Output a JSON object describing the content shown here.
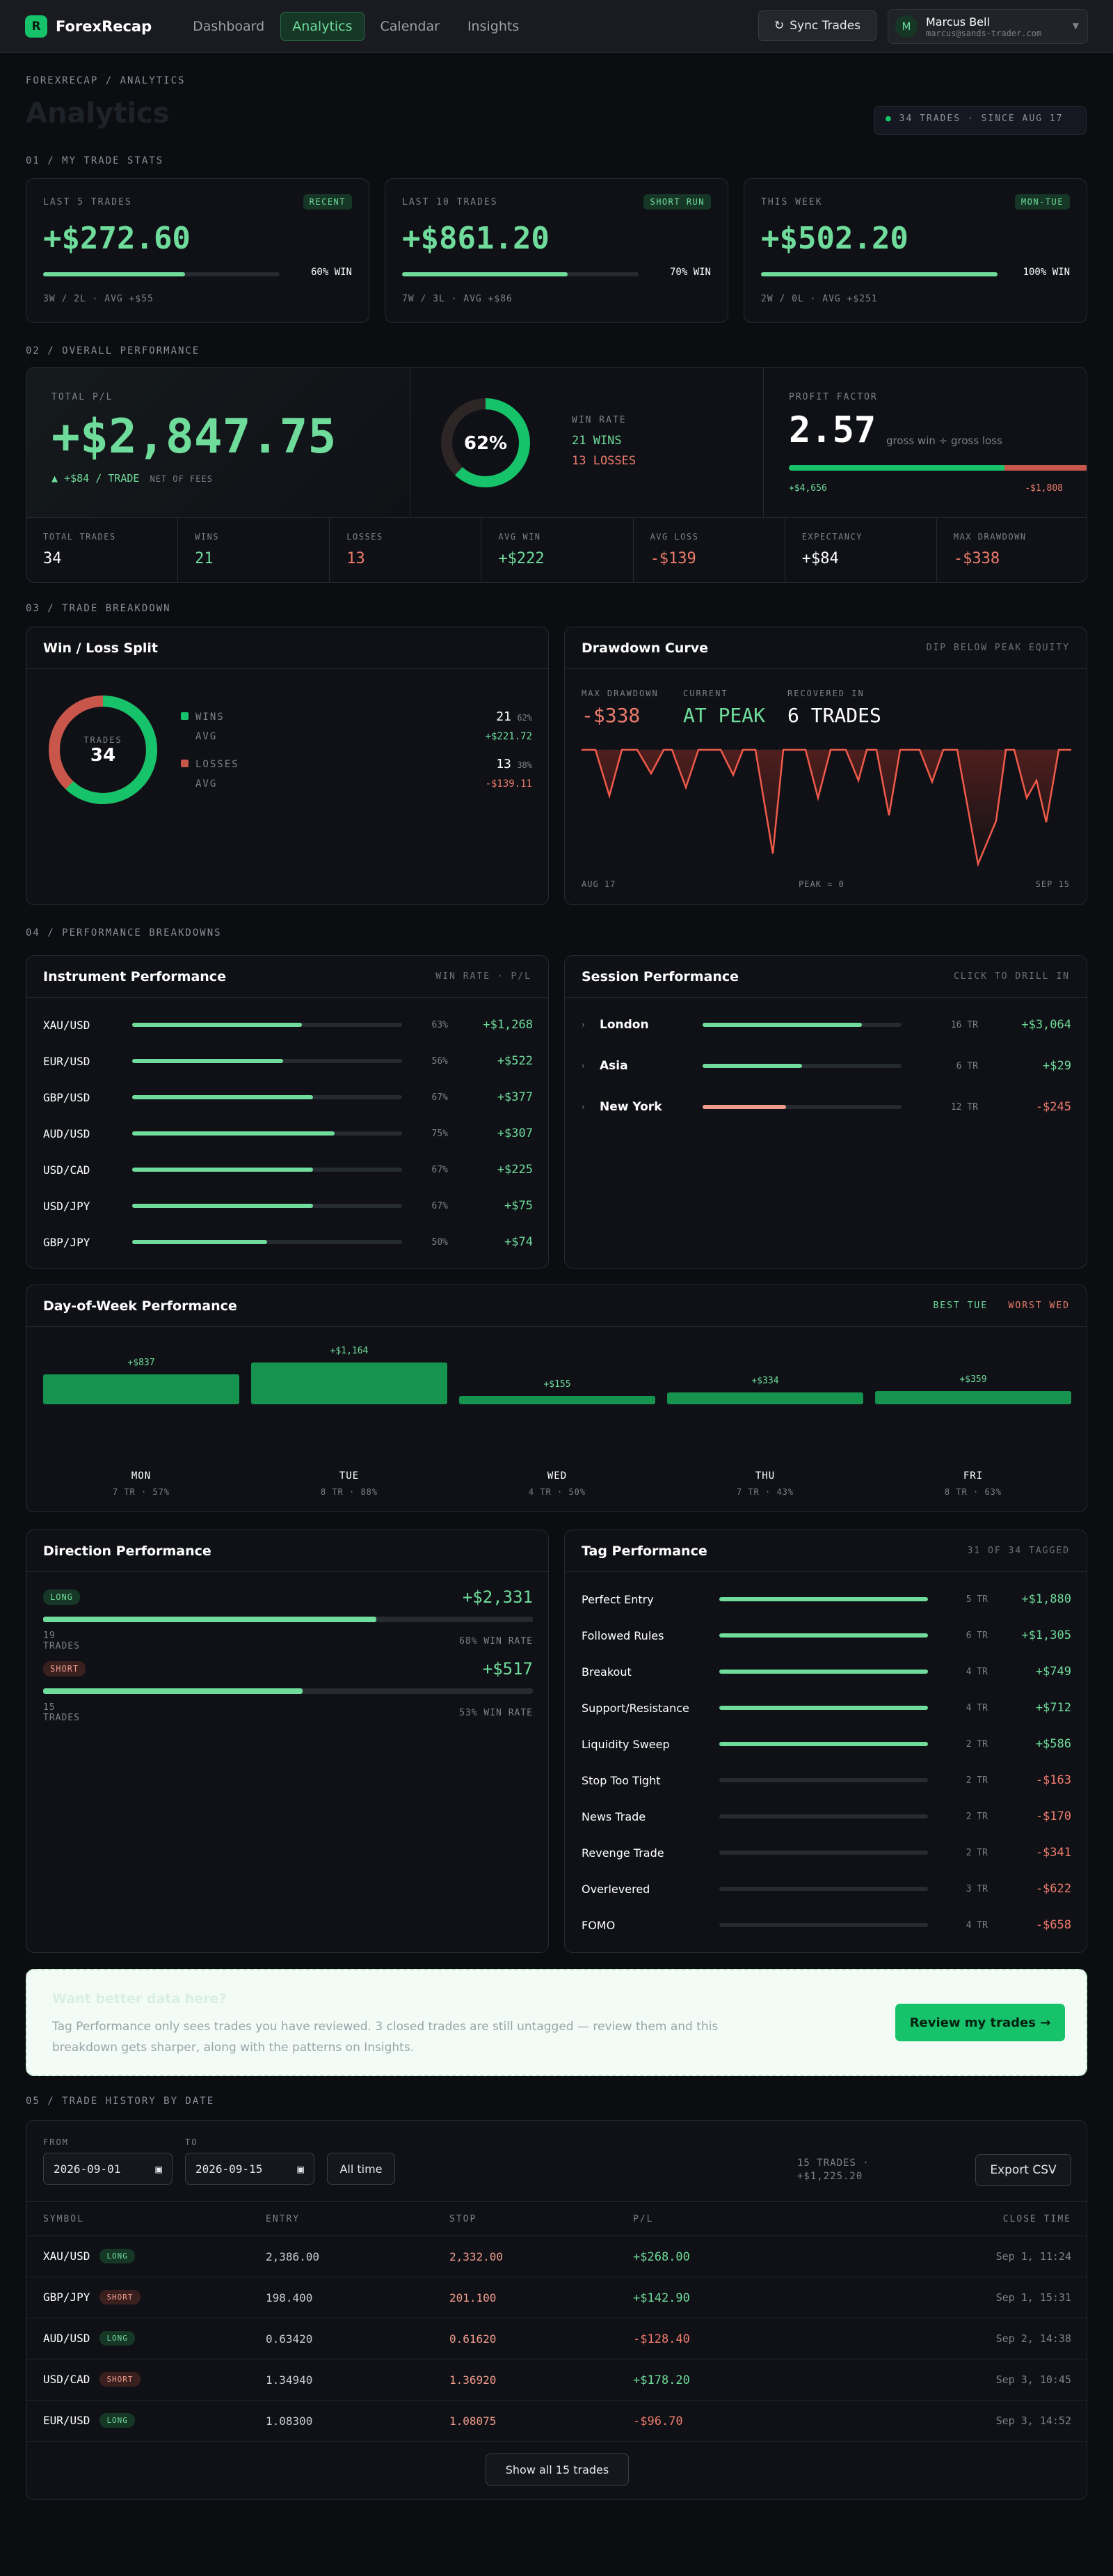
{
  "app": {
    "logo_letter": "R",
    "name": "ForexRecap",
    "nav": [
      "Dashboard",
      "Analytics",
      "Calendar",
      "Insights"
    ],
    "sync_label": "Sync Trades",
    "user": {
      "initial": "M",
      "name": "Marcus Bell",
      "email": "marcus@sands-trader.com"
    }
  },
  "header": {
    "breadcrumb": "FOREXRECAP / ANALYTICS",
    "title": "Analytics",
    "since": "34 TRADES · SINCE AUG 17"
  },
  "s1": {
    "label": "01 / MY TRADE STATS",
    "cards": [
      {
        "name": "LAST 5 TRADES",
        "badge": "RECENT",
        "value": "+$272.60",
        "pct": 60,
        "win": "60% WIN",
        "foot": "3W / 2L · AVG +$55"
      },
      {
        "name": "LAST 10 TRADES",
        "badge": "SHORT RUN",
        "value": "+$861.20",
        "pct": 70,
        "win": "70% WIN",
        "foot": "7W / 3L · AVG +$86"
      },
      {
        "name": "THIS WEEK",
        "badge": "MON-TUE",
        "value": "+$502.20",
        "pct": 100,
        "win": "100% WIN",
        "foot": "2W / 0L · AVG +$251"
      }
    ]
  },
  "s2": {
    "label": "02 / OVERALL PERFORMANCE",
    "total_label": "TOTAL P/L",
    "total": "+$2,847.75",
    "per_trade": "▲ +$84 / TRADE",
    "net": "NET OF FEES",
    "donut_pct": "62%",
    "win_rate_pct": 62,
    "wr_label": "WIN RATE",
    "wins": "21 WINS",
    "losses": "13 LOSSES",
    "pf_label": "PROFIT FACTOR",
    "pf": "2.57",
    "pf_desc": "gross win ÷ gross loss",
    "gross_win": "+$4,656",
    "gross_loss": "-$1,808",
    "gross_win_share": 72,
    "stats": [
      {
        "label": "TOTAL TRADES",
        "value": "34",
        "tone": "w"
      },
      {
        "label": "WINS",
        "value": "21",
        "tone": "g"
      },
      {
        "label": "LOSSES",
        "value": "13",
        "tone": "r"
      },
      {
        "label": "AVG WIN",
        "value": "+$222",
        "tone": "g"
      },
      {
        "label": "AVG LOSS",
        "value": "-$139",
        "tone": "r"
      },
      {
        "label": "EXPECTANCY",
        "value": "+$84",
        "tone": "w"
      },
      {
        "label": "MAX DRAWDOWN",
        "value": "-$338",
        "tone": "r"
      }
    ]
  },
  "s3": {
    "label": "03 / TRADE BREAKDOWN",
    "wl": {
      "title": "Win / Loss Split",
      "center_label": "TRADES",
      "center_value": "34",
      "wins_label": "WINS",
      "wins": "21",
      "wins_pct": "62%",
      "avg_label": "AVG",
      "avg_win": "+$221.72",
      "losses_label": "LOSSES",
      "losses": "13",
      "losses_pct": "38%",
      "avg_loss": "-$139.11",
      "win_share": 62
    },
    "dd": {
      "title": "Drawdown Curve",
      "hint": "DIP BELOW PEAK EQUITY",
      "max_label": "MAX DRAWDOWN",
      "max": "-$338",
      "cur_label": "CURRENT",
      "cur": "AT PEAK",
      "rec_label": "RECOVERED IN",
      "rec": "6 TRADES",
      "start": "AUG 17",
      "mid": "PEAK = 0",
      "end": "SEP 15"
    }
  },
  "s4": {
    "label": "04 / PERFORMANCE BREAKDOWNS",
    "instr": {
      "title": "Instrument Performance",
      "hint": "WIN RATE · P/L",
      "rows": [
        {
          "sym": "XAU/USD",
          "pct": 63,
          "wr": "63%",
          "pl": "+$1,268"
        },
        {
          "sym": "EUR/USD",
          "pct": 56,
          "wr": "56%",
          "pl": "+$522"
        },
        {
          "sym": "GBP/USD",
          "pct": 67,
          "wr": "67%",
          "pl": "+$377"
        },
        {
          "sym": "AUD/USD",
          "pct": 75,
          "wr": "75%",
          "pl": "+$307"
        },
        {
          "sym": "USD/CAD",
          "pct": 67,
          "wr": "67%",
          "pl": "+$225"
        },
        {
          "sym": "USD/JPY",
          "pct": 67,
          "wr": "67%",
          "pl": "+$75"
        },
        {
          "sym": "GBP/JPY",
          "pct": 50,
          "wr": "50%",
          "pl": "+$74"
        }
      ]
    },
    "sess": {
      "title": "Session Performance",
      "hint": "CLICK TO DRILL IN",
      "rows": [
        {
          "name": "London",
          "pct": 80,
          "tr": "16 TR",
          "pl": "+$3,064",
          "tone": "g"
        },
        {
          "name": "Asia",
          "pct": 50,
          "tr": "6 TR",
          "pl": "+$29",
          "tone": "g"
        },
        {
          "name": "New York",
          "pct": 42,
          "tr": "12 TR",
          "pl": "-$245",
          "tone": "r"
        }
      ]
    },
    "dow": {
      "title": "Day-of-Week Performance",
      "best": "BEST TUE",
      "worst": "WORST WED",
      "days": [
        {
          "day": "MON",
          "val": "+$837",
          "amt": 837,
          "sub": "7 TR · 57%"
        },
        {
          "day": "TUE",
          "val": "+$1,164",
          "amt": 1164,
          "sub": "8 TR · 88%"
        },
        {
          "day": "WED",
          "val": "+$155",
          "amt": 155,
          "sub": "4 TR · 50%"
        },
        {
          "day": "THU",
          "val": "+$334",
          "amt": 334,
          "sub": "7 TR · 43%"
        },
        {
          "day": "FRI",
          "val": "+$359",
          "amt": 359,
          "sub": "8 TR · 63%"
        }
      ]
    },
    "dir": {
      "title": "Direction Performance",
      "long": {
        "tag": "LONG",
        "value": "+$2,331",
        "pct": 68,
        "count": "19",
        "unit": "TRADES",
        "wr": "68% WIN RATE"
      },
      "short": {
        "tag": "SHORT",
        "value": "+$517",
        "pct": 53,
        "count": "15",
        "unit": "TRADES",
        "wr": "53% WIN RATE"
      }
    },
    "tag": {
      "title": "Tag Performance",
      "hint": "31 OF 34 TAGGED",
      "rows": [
        {
          "name": "Perfect Entry",
          "tr": "5 TR",
          "pl": "+$1,880",
          "tone": "g",
          "fill": 1
        },
        {
          "name": "Followed Rules",
          "tr": "6 TR",
          "pl": "+$1,305",
          "tone": "g",
          "fill": 1
        },
        {
          "name": "Breakout",
          "tr": "4 TR",
          "pl": "+$749",
          "tone": "g",
          "fill": 1
        },
        {
          "name": "Support/Resistance",
          "tr": "4 TR",
          "pl": "+$712",
          "tone": "g",
          "fill": 1
        },
        {
          "name": "Liquidity Sweep",
          "tr": "2 TR",
          "pl": "+$586",
          "tone": "g",
          "fill": 1
        },
        {
          "name": "Stop Too Tight",
          "tr": "2 TR",
          "pl": "-$163",
          "tone": "r",
          "fill": 0
        },
        {
          "name": "News Trade",
          "tr": "2 TR",
          "pl": "-$170",
          "tone": "r",
          "fill": 0
        },
        {
          "name": "Revenge Trade",
          "tr": "2 TR",
          "pl": "-$341",
          "tone": "r",
          "fill": 0
        },
        {
          "name": "Overlevered",
          "tr": "3 TR",
          "pl": "-$622",
          "tone": "r",
          "fill": 0
        },
        {
          "name": "FOMO",
          "tr": "4 TR",
          "pl": "-$658",
          "tone": "r",
          "fill": 0
        }
      ]
    }
  },
  "cta": {
    "title": "Want better data here?",
    "text": "Tag Performance only sees trades you have reviewed. 3 closed trades are still untagged — review them and this breakdown gets sharper, along with the patterns on Insights.",
    "button": "Review my trades →"
  },
  "s5": {
    "label": "05 / TRADE HISTORY BY DATE",
    "from_label": "FROM",
    "from": "2026-09-01",
    "to_label": "TO",
    "to": "2026-09-15",
    "all_time": "All time",
    "summary": "15 TRADES · +$1,225.20",
    "export": "Export CSV",
    "cols": [
      "SYMBOL",
      "ENTRY",
      "STOP",
      "P/L",
      "CLOSE TIME"
    ],
    "rows": [
      {
        "sym": "XAU/USD",
        "dir": "LONG",
        "entry": "2,386.00",
        "stop": "2,332.00",
        "pl": "+$268.00",
        "tone": "g",
        "time": "Sep 1, 11:24"
      },
      {
        "sym": "GBP/JPY",
        "dir": "SHORT",
        "entry": "198.400",
        "stop": "201.100",
        "pl": "+$142.90",
        "tone": "g",
        "time": "Sep 1, 15:31"
      },
      {
        "sym": "AUD/USD",
        "dir": "LONG",
        "entry": "0.63420",
        "stop": "0.61620",
        "pl": "-$128.40",
        "tone": "r",
        "time": "Sep 2, 14:38"
      },
      {
        "sym": "USD/CAD",
        "dir": "SHORT",
        "entry": "1.34940",
        "stop": "1.36920",
        "pl": "+$178.20",
        "tone": "g",
        "time": "Sep 3, 10:45"
      },
      {
        "sym": "EUR/USD",
        "dir": "LONG",
        "entry": "1.08300",
        "stop": "1.08075",
        "pl": "-$96.70",
        "tone": "r",
        "time": "Sep 3, 14:52"
      }
    ],
    "show_all": "Show all 15 trades"
  },
  "colors": {
    "green": "#16c26a",
    "green_text": "#6fdc9b",
    "red": "#ef7c6c",
    "bg": "#0b0d11",
    "panel": "#0f1116"
  }
}
